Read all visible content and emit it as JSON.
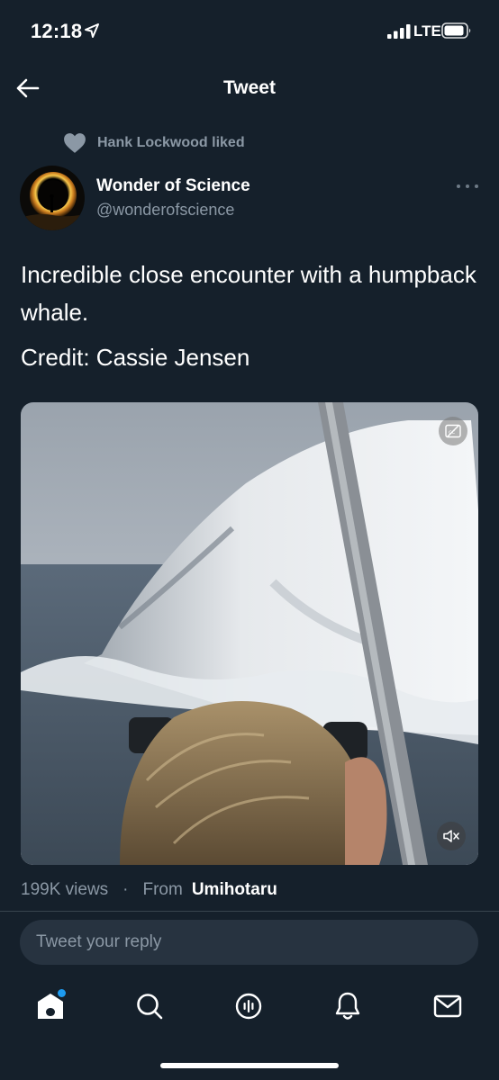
{
  "status_bar": {
    "time": "12:18",
    "network": "LTE"
  },
  "nav": {
    "title": "Tweet"
  },
  "social_context": {
    "text": "Hank Lockwood liked"
  },
  "author": {
    "name": "Wonder of Science",
    "handle": "@wonderofscience"
  },
  "tweet": {
    "text": "Incredible close encounter with a humpback whale.",
    "credit": "Credit: Cassie Jensen"
  },
  "media": {
    "cc_icon": "closed-captions-icon",
    "mute_icon": "speaker-muted-icon"
  },
  "meta": {
    "views": "199K views",
    "separator": "·",
    "from_label": "From",
    "source": "Umihotaru"
  },
  "reply": {
    "placeholder": "Tweet your reply"
  },
  "tab_bar": {
    "items": [
      "home-icon",
      "search-icon",
      "spaces-icon",
      "notifications-icon",
      "messages-icon"
    ]
  },
  "colors": {
    "background": "#15202b",
    "secondary_text": "#8b98a5",
    "accent": "#1d9bf0",
    "input_bg": "#273340"
  }
}
